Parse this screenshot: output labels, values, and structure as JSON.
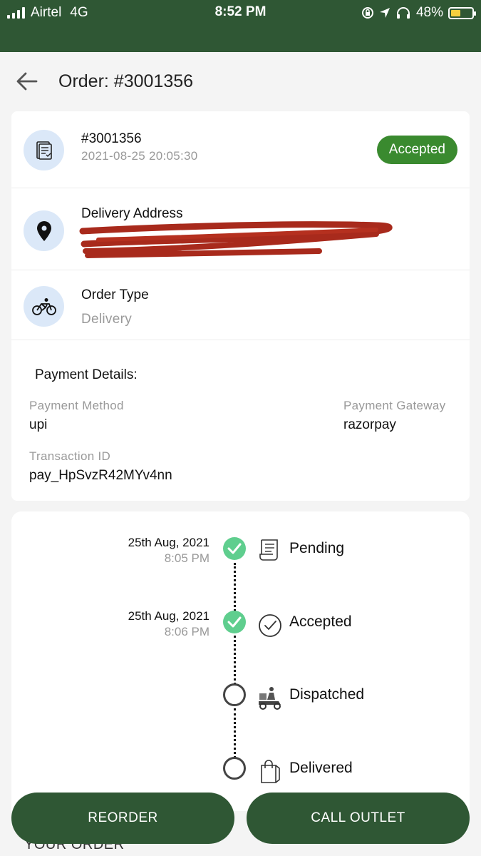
{
  "status_bar": {
    "carrier": "Airtel",
    "network": "4G",
    "time": "8:52 PM",
    "battery": "48%",
    "battery_level": 0.48
  },
  "app_bar": {
    "title": "Order: #3001356"
  },
  "order": {
    "number": "#3001356",
    "datetime": "2021-08-25 20:05:30",
    "status": "Accepted"
  },
  "delivery": {
    "label": "Delivery Address"
  },
  "order_type": {
    "label": "Order Type",
    "value": "Delivery"
  },
  "payment": {
    "title": "Payment Details:",
    "method_label": "Payment Method",
    "method_value": "upi",
    "gateway_label": "Payment Gateway",
    "gateway_value": "razorpay",
    "txn_label": "Transaction ID",
    "txn_value": "pay_HpSvzR42MYv4nn"
  },
  "timeline": [
    {
      "label": "Pending",
      "date": "25th Aug, 2021",
      "time": "8:05 PM",
      "done": true,
      "icon": "receipt-icon"
    },
    {
      "label": "Accepted",
      "date": "25th Aug, 2021",
      "time": "8:06 PM",
      "done": true,
      "icon": "check-circle-icon"
    },
    {
      "label": "Dispatched",
      "date": "",
      "time": "",
      "done": false,
      "icon": "delivery-scooter-icon"
    },
    {
      "label": "Delivered",
      "date": "",
      "time": "",
      "done": false,
      "icon": "shopping-bag-icon"
    }
  ],
  "below_text": "YOUR ORDER",
  "buttons": {
    "reorder": "REORDER",
    "call_outlet": "CALL OUTLET"
  },
  "colors": {
    "brand_green": "#2f5734",
    "badge_green": "#3a8a2f",
    "done_green": "#5fce8e",
    "icon_bg": "#dbe8f8",
    "redaction": "#a82a1c"
  }
}
